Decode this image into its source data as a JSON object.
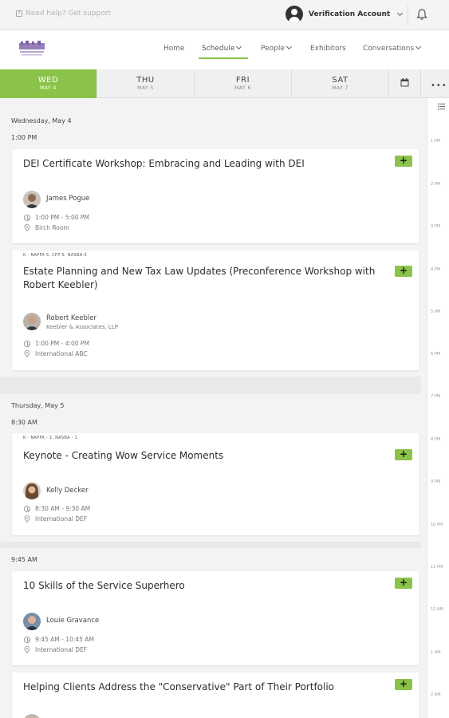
{
  "topbar": {
    "help_text": "Need help? Get support",
    "account_name": "Verification Account"
  },
  "nav": {
    "items": [
      {
        "label": "Home"
      },
      {
        "label": "Schedule"
      },
      {
        "label": "People"
      },
      {
        "label": "Exhibitors"
      },
      {
        "label": "Conversations"
      }
    ]
  },
  "days": [
    {
      "name": "WED",
      "date": "MAY 4"
    },
    {
      "name": "THU",
      "date": "MAY 5"
    },
    {
      "name": "FRI",
      "date": "MAY 6"
    },
    {
      "name": "SAT",
      "date": "MAY 7"
    }
  ],
  "timeline": [
    "1 PM",
    "2 PM",
    "3 PM",
    "4 PM",
    "5 PM",
    "6 PM",
    "7 PM",
    "8 PM",
    "9 PM",
    "10 PM",
    "11 PM",
    "12 AM",
    "1 AM",
    "2 AM"
  ],
  "sections": [
    {
      "date": "Wednesday, May 4",
      "time": "1:00 PM"
    },
    {
      "date": "Thursday, May 5",
      "time": "8:30 AM"
    },
    {
      "time": "9:45 AM"
    }
  ],
  "sessions": [
    {
      "title": "DEI Certificate Workshop: Embracing and Leading with DEI",
      "speaker": "James Pogue",
      "time": "1:00 PM - 5:00 PM",
      "location": "Birch Room"
    },
    {
      "tag": "K - NAPFA-5, CFP-5, NASBA-5",
      "title": "Estate Planning and New Tax Law Updates (Preconference Workshop with Robert Keebler)",
      "speaker": "Robert Keebler",
      "org": "Keebler & Associates, LLP",
      "time": "1:00 PM - 4:00 PM",
      "location": "International ABC"
    },
    {
      "tag": "K - NAPFA - 1, NASBA - 1",
      "title": "Keynote - Creating Wow Service Moments",
      "speaker": "Kelly Decker",
      "time": "8:30 AM - 9:30 AM",
      "location": "International DEF"
    },
    {
      "title": "10 Skills of the Service Superhero",
      "speaker": "Louie Gravance",
      "time": "9:45 AM - 10:45 AM",
      "location": "International DEF"
    },
    {
      "title": "Helping Clients Address the \"Conservative\" Part of Their Portfolio"
    }
  ],
  "add_label": "+",
  "colors": {
    "accent": "#8bc34a"
  }
}
